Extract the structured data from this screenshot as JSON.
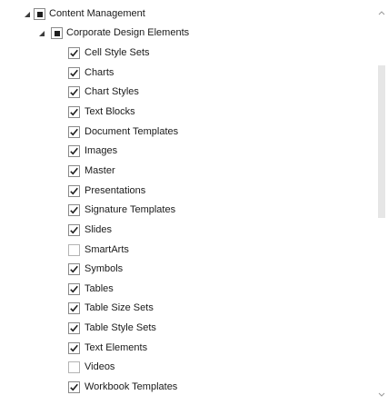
{
  "tree": {
    "root": {
      "label": "Content Management",
      "state": "indeterminate",
      "expanded": true
    },
    "group": {
      "label": "Corporate Design Elements",
      "state": "indeterminate",
      "expanded": true
    },
    "items": [
      {
        "label": "Cell Style Sets",
        "checked": true
      },
      {
        "label": "Charts",
        "checked": true
      },
      {
        "label": "Chart Styles",
        "checked": true
      },
      {
        "label": "Text Blocks",
        "checked": true
      },
      {
        "label": "Document Templates",
        "checked": true
      },
      {
        "label": "Images",
        "checked": true
      },
      {
        "label": "Master",
        "checked": true
      },
      {
        "label": "Presentations",
        "checked": true
      },
      {
        "label": "Signature Templates",
        "checked": true
      },
      {
        "label": "Slides",
        "checked": true
      },
      {
        "label": "SmartArts",
        "checked": false
      },
      {
        "label": "Symbols",
        "checked": true
      },
      {
        "label": "Tables",
        "checked": true
      },
      {
        "label": "Table Size Sets",
        "checked": true
      },
      {
        "label": "Table Style Sets",
        "checked": true
      },
      {
        "label": "Text Elements",
        "checked": true
      },
      {
        "label": "Videos",
        "checked": false
      },
      {
        "label": "Workbook Templates",
        "checked": true
      }
    ]
  },
  "colors": {
    "checkbox_border": "#8a8a8a",
    "check_mark": "#1f1f1f",
    "scroll_thumb": "#e6e6e6"
  }
}
